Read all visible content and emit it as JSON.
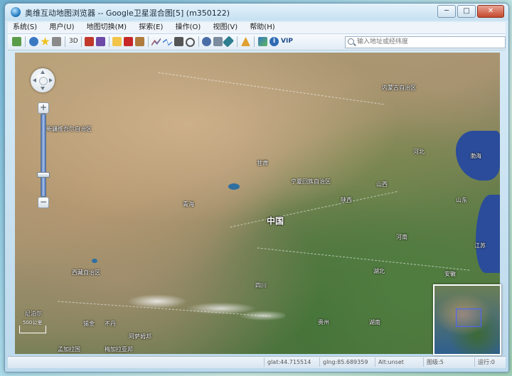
{
  "window": {
    "title": "奥维互动地图浏览器 -- Google卫星混合图[5] (m350122)",
    "min_label": "─",
    "max_label": "□",
    "close_label": "✕"
  },
  "menu": {
    "items": [
      {
        "label": "系统(S)"
      },
      {
        "label": "用户(U)"
      },
      {
        "label": "地图切换(M)"
      },
      {
        "label": "探索(E)"
      },
      {
        "label": "操作(O)"
      },
      {
        "label": "视图(V)"
      },
      {
        "label": "帮助(H)"
      }
    ]
  },
  "toolbar": {
    "label_3d": "3D",
    "label_vip": "VIP",
    "search_placeholder": "输入地址或经纬度"
  },
  "map": {
    "labels": [
      {
        "text": "内蒙古自治区"
      },
      {
        "text": "新疆维吾尔自治区"
      },
      {
        "text": "甘肃"
      },
      {
        "text": "宁夏回族自治区"
      },
      {
        "text": "青海"
      },
      {
        "text": "山西"
      },
      {
        "text": "陕西"
      },
      {
        "text": "河北"
      },
      {
        "text": "渤海"
      },
      {
        "text": "山东"
      },
      {
        "text": "中国"
      },
      {
        "text": "河南"
      },
      {
        "text": "江苏"
      },
      {
        "text": "安徽"
      },
      {
        "text": "湖北"
      },
      {
        "text": "四川"
      },
      {
        "text": "西藏自治区"
      },
      {
        "text": "贵州"
      },
      {
        "text": "湖南"
      },
      {
        "text": "不丹"
      },
      {
        "text": "阿萨姆邦"
      },
      {
        "text": "梅加拉亚邦"
      },
      {
        "text": "锡金"
      },
      {
        "text": "孟加拉国"
      },
      {
        "text": "尼泊尔"
      }
    ],
    "scale_label": "500公里",
    "zoom_plus": "+",
    "zoom_minus": "−"
  },
  "status": {
    "lat": "glat:44.715514",
    "lng": "glng:85.689359",
    "alt": "Alt:unset",
    "level": "图级:5",
    "state": "运行:0"
  }
}
